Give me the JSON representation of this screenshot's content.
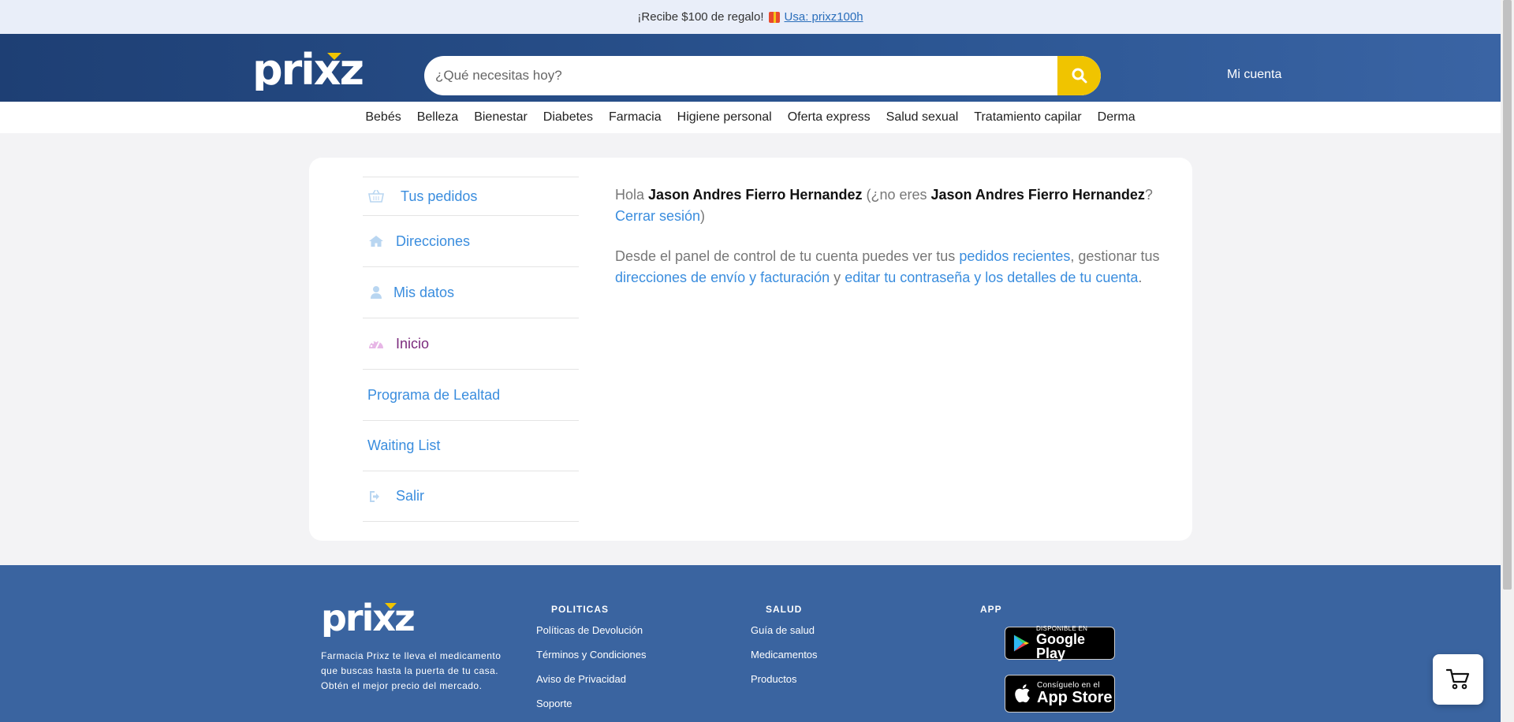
{
  "promo": {
    "text": "¡Recibe $100 de regalo!",
    "link": "Usa: prixz100h"
  },
  "header": {
    "logo_text": "prixz",
    "search_placeholder": "¿Qué necesitas hoy?",
    "account_link": "Mi cuenta"
  },
  "categories": [
    "Bebés",
    "Belleza",
    "Bienestar",
    "Diabetes",
    "Farmacia",
    "Higiene personal",
    "Oferta express",
    "Salud sexual",
    "Tratamiento capilar",
    "Derma"
  ],
  "sidebar": {
    "items": [
      {
        "label": "Tus pedidos",
        "icon": "basket-icon"
      },
      {
        "label": "Direcciones",
        "icon": "home-icon"
      },
      {
        "label": "Mis datos",
        "icon": "user-icon"
      },
      {
        "label": "Inicio",
        "icon": "dashboard-icon",
        "active": true
      },
      {
        "label": "Programa de Lealtad"
      },
      {
        "label": "Waiting List"
      },
      {
        "label": "Salir",
        "icon": "logout-icon"
      }
    ]
  },
  "welcome": {
    "hello": "Hola",
    "name": "Jason Andres Fierro Hernandez",
    "not_you": "(¿no eres",
    "name2": "Jason Andres Fierro Hernandez",
    "question_mark": "?",
    "logout_link": "Cerrar sesión",
    "close_paren": ")",
    "desc_1": "Desde el panel de control de tu cuenta puedes ver tus",
    "link_orders": "pedidos recientes",
    "desc_2": ", gestionar tus",
    "link_addresses": "direcciones de envío y facturación",
    "desc_3": "y",
    "link_password": "editar tu contraseña y los detalles de tu cuenta",
    "desc_4": "."
  },
  "footer": {
    "logo_text": "prixz",
    "tagline": "Farmacia Prixz te lleva el medicamento que buscas hasta la puerta de tu casa. Obtén el mejor precio del mercado.",
    "policies_title": "POLITICAS",
    "policies": [
      "Políticas de Devolución",
      "Términos y Condiciones",
      "Aviso de Privacidad",
      "Soporte"
    ],
    "health_title": "SALUD",
    "health": [
      "Guía de salud",
      "Medicamentos",
      "Productos"
    ],
    "app_title": "APP",
    "google_small": "DISPONIBLE EN",
    "google_big": "Google Play",
    "apple_small": "Consíguelo en el",
    "apple_big": "App Store"
  },
  "colors": {
    "header_dark": "#1e3f74",
    "accent_yellow": "#f0c400",
    "link_blue": "#3a8dde",
    "active_purple": "#7b2b7d",
    "footer_blue": "#3a64a0"
  }
}
